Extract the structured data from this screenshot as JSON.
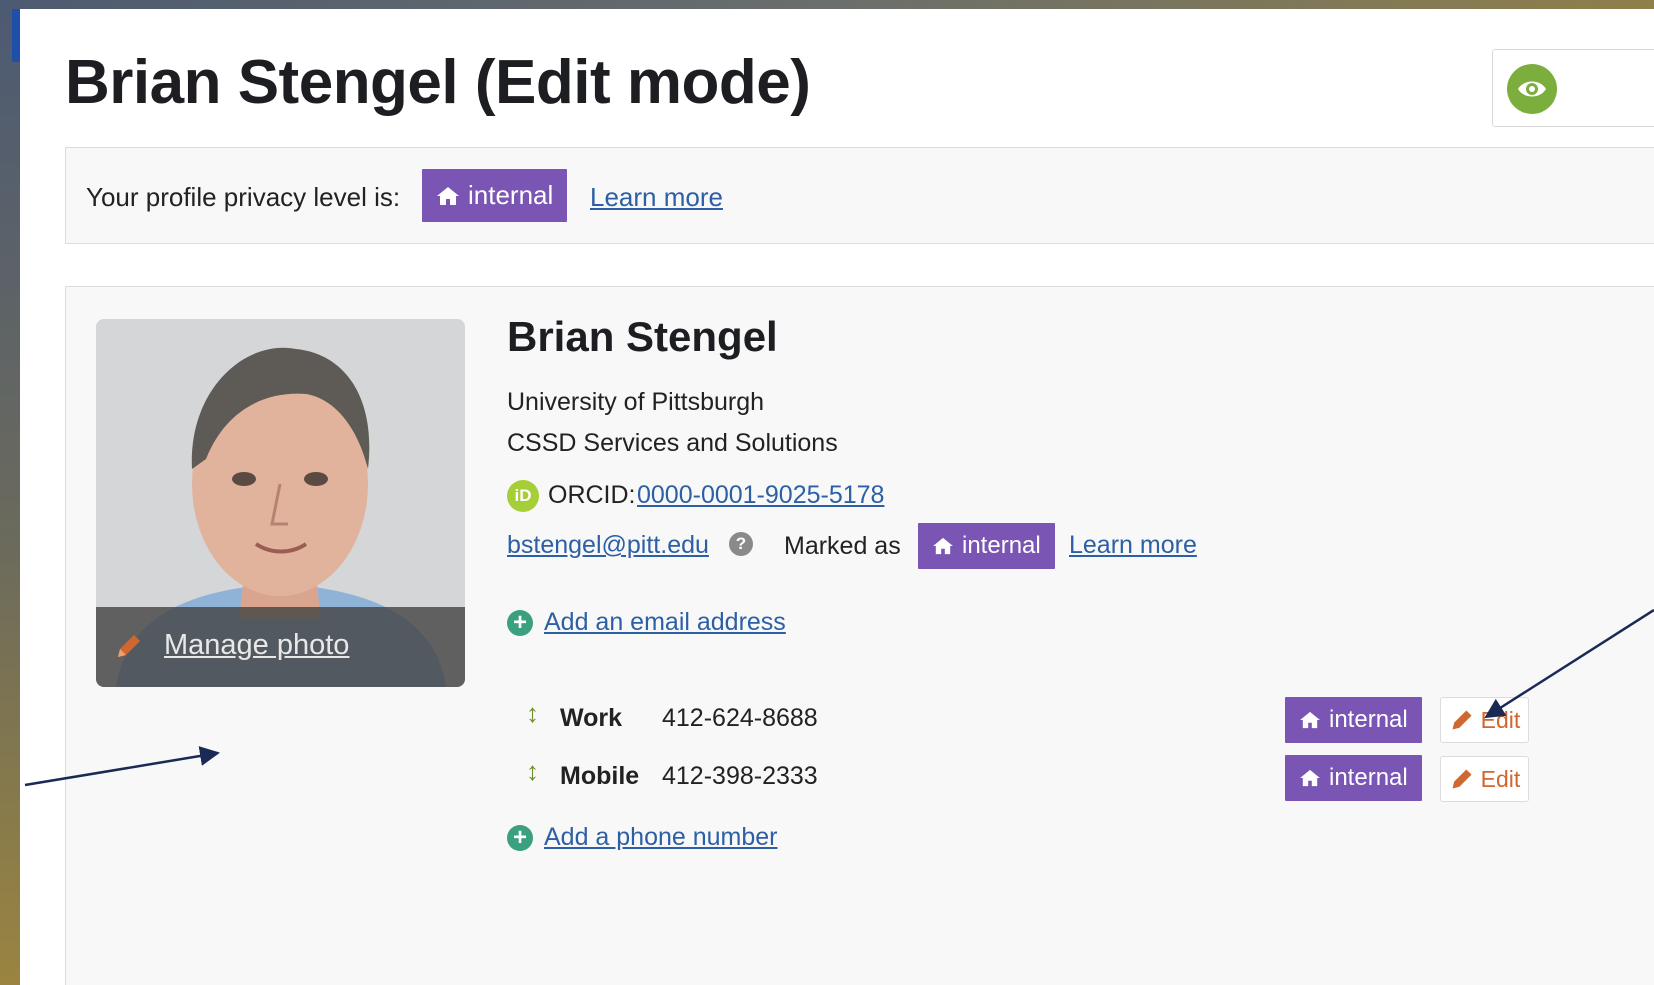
{
  "page": {
    "title": "Brian Stengel (Edit mode)"
  },
  "privacy": {
    "label": "Your profile privacy level is:",
    "level": "internal",
    "learn_more": "Learn more"
  },
  "profile": {
    "manage_photo": "Manage photo",
    "name": "Brian Stengel",
    "organization": "University of Pittsburgh",
    "department": "CSSD Services and Solutions",
    "orcid_icon": "iD",
    "orcid_label": "ORCID:",
    "orcid_id": "0000-0001-9025-5178",
    "email": "bstengel@pitt.edu",
    "help_icon": "?",
    "marked_as": "Marked as",
    "email_privacy": "internal",
    "learn_more": "Learn more",
    "add_email": "Add an email address",
    "phones": [
      {
        "type": "Work",
        "number": "412-624-8688",
        "privacy": "internal",
        "edit": "Edit"
      },
      {
        "type": "Mobile",
        "number": "412-398-2333",
        "privacy": "internal",
        "edit": "Edit"
      }
    ],
    "add_phone": "Add a phone number"
  },
  "icons": {
    "badge_icon": "home-icon",
    "edit_icon": "pencil-icon",
    "add_icon": "plus-circle-icon",
    "sort_icon": "up-down-icon",
    "view_icon": "eye-icon"
  },
  "colors": {
    "privacy_badge": "#7a55b3",
    "link": "#2d5fa5",
    "edit_orange": "#d0672f",
    "add_green": "#3aa07f",
    "orcid_green": "#a6ce39",
    "view_green": "#7cae3e"
  }
}
